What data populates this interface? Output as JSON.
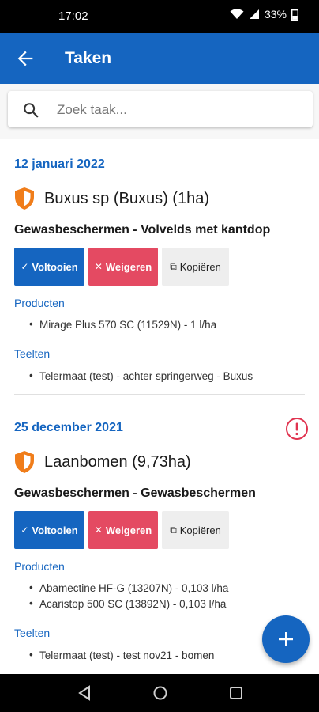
{
  "status": {
    "time": "17:02",
    "battery": "33%"
  },
  "appbar": {
    "title": "Taken"
  },
  "search": {
    "placeholder": "Zoek taak..."
  },
  "tasks": [
    {
      "date": "12 januari 2022",
      "name": "Buxus sp (Buxus) (1ha)",
      "operation": "Gewasbeschermen - Volvelds met kantdop",
      "buttons": {
        "complete": "Voltooien",
        "refuse": "Weigeren",
        "copy": "Kopiëren"
      },
      "products_label": "Producten",
      "products": [
        "Mirage Plus 570 SC (11529N) - 1 l/ha"
      ],
      "crops_label": "Teelten",
      "crops": [
        "Telermaat (test) - achter springerweg - Buxus"
      ],
      "alert": false
    },
    {
      "date": "25 december 2021",
      "name": "Laanbomen (9,73ha)",
      "operation": "Gewasbeschermen - Gewasbeschermen",
      "buttons": {
        "complete": "Voltooien",
        "refuse": "Weigeren",
        "copy": "Kopiëren"
      },
      "products_label": "Producten",
      "products": [
        "Abamectine HF-G (13207N) - 0,103 l/ha",
        "Acaristop 500 SC (13892N) - 0,103 l/ha"
      ],
      "crops_label": "Teelten",
      "crops": [
        "Telermaat (test) - test nov21 - bomen"
      ],
      "alert": true
    }
  ],
  "colors": {
    "primary": "#1565c0",
    "refuse": "#e44a62",
    "shield": "#f07d1a",
    "alert": "#e0334f"
  }
}
